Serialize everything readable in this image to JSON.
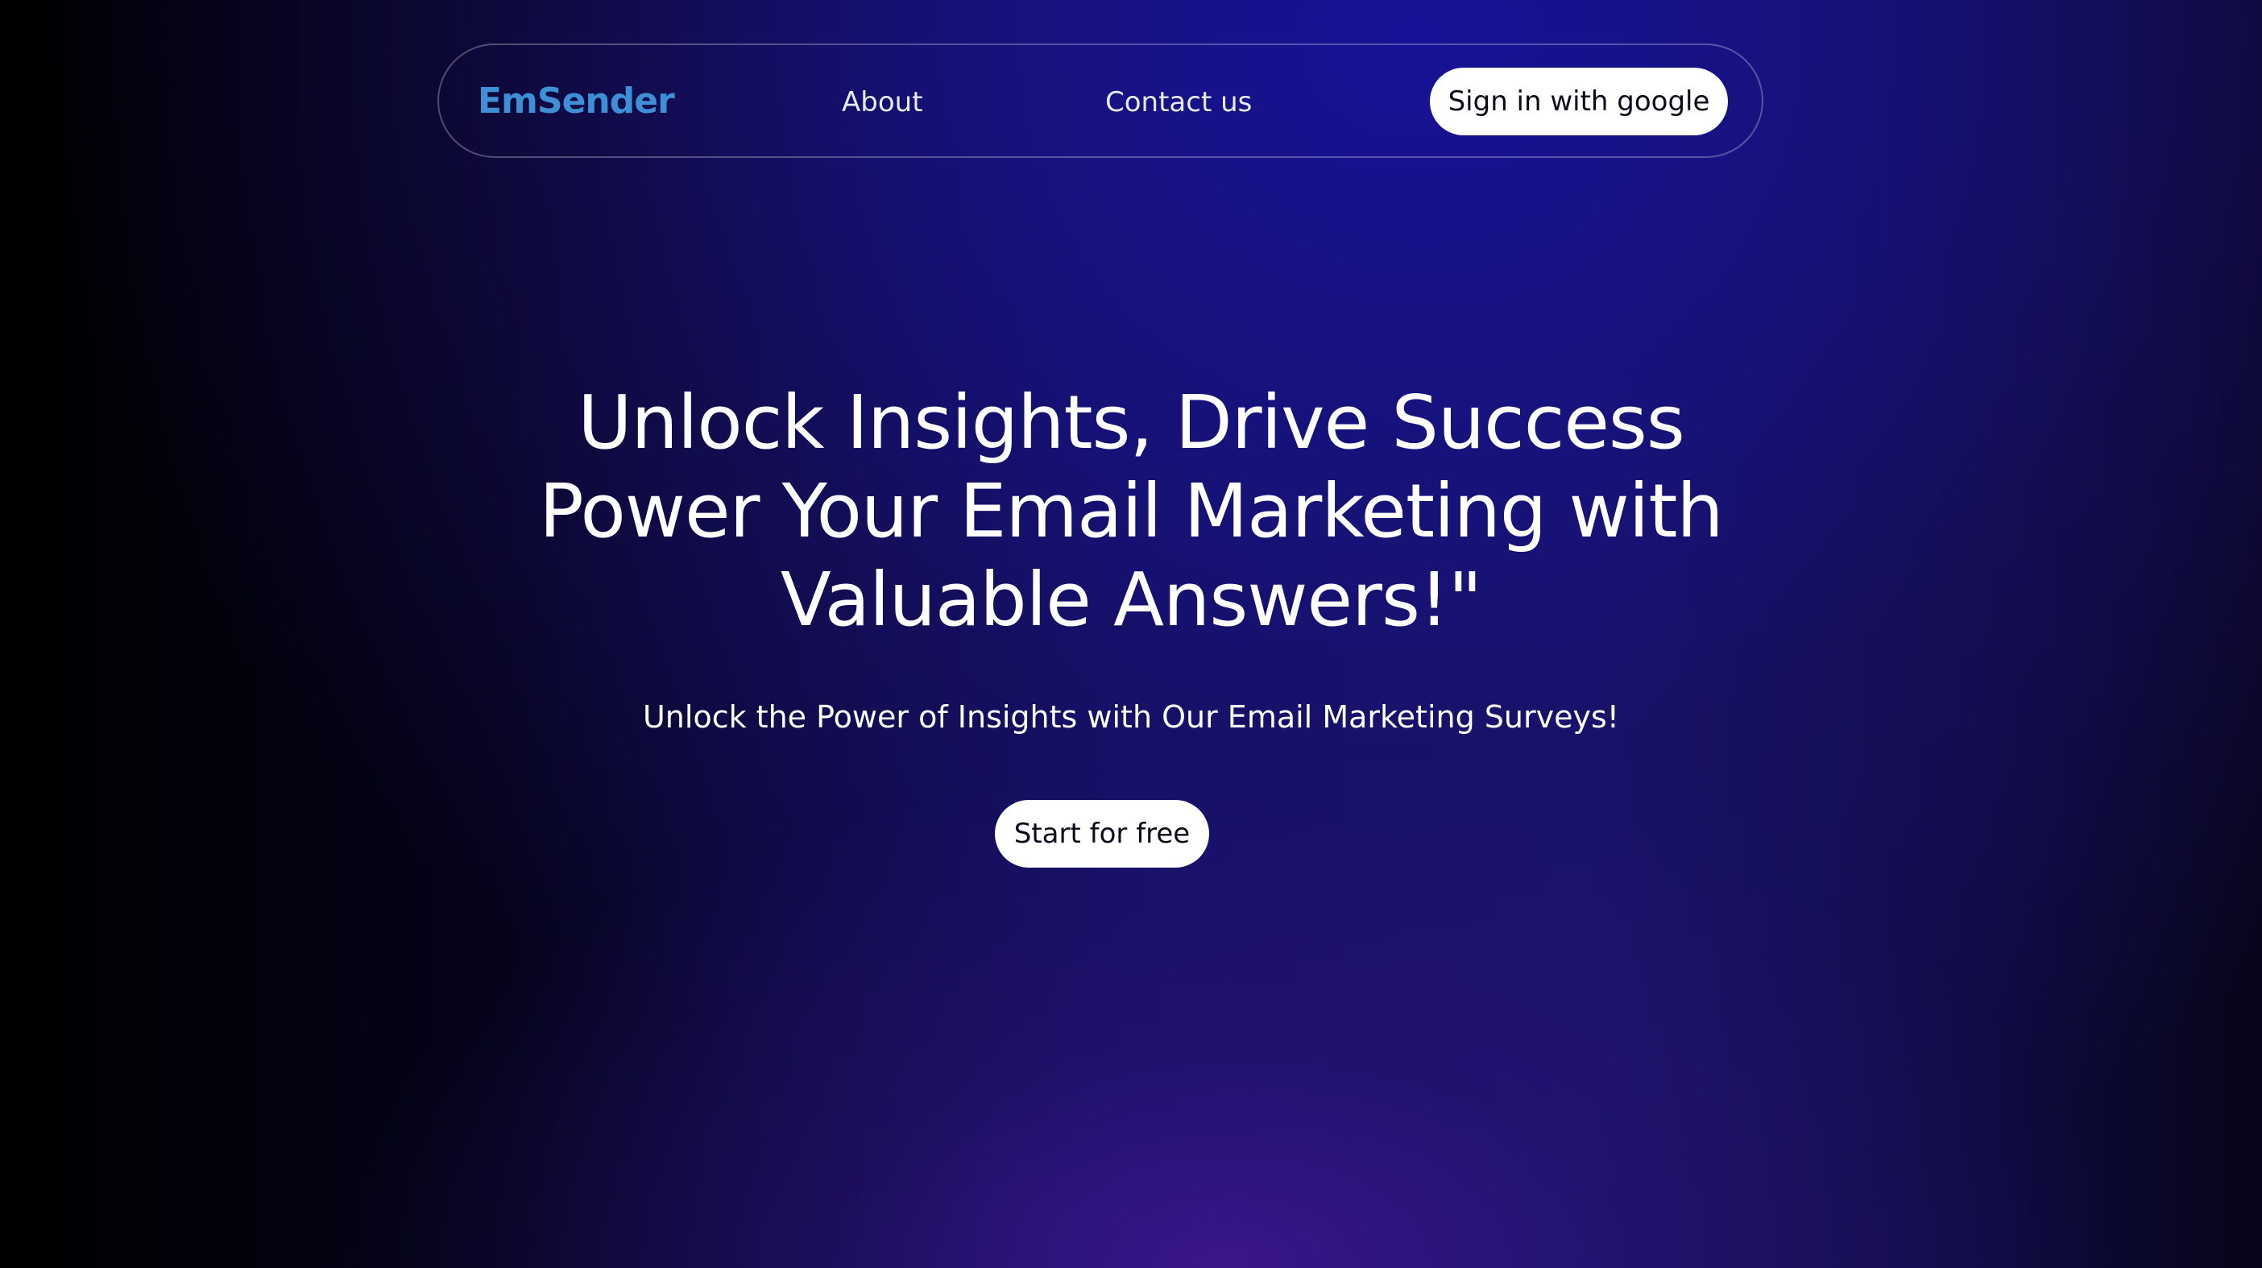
{
  "header": {
    "logo": "EmSender",
    "nav": {
      "about": "About",
      "contact": "Contact us"
    },
    "signin_label": "Sign in with google"
  },
  "hero": {
    "title_lines": [
      "Unlock Insights, Drive Success",
      "Power Your Email Marketing with",
      "Valuable Answers!\""
    ],
    "subtitle": "Unlock the Power of Insights with Our Email Marketing Surveys!",
    "cta_label": "Start for free"
  },
  "colors": {
    "logo": "#3f8fd6",
    "text": "#ffffff",
    "button_bg": "#ffffff",
    "button_text": "#0b0b1a",
    "accent_blue": "#16128f",
    "accent_purple": "#3c168c"
  }
}
